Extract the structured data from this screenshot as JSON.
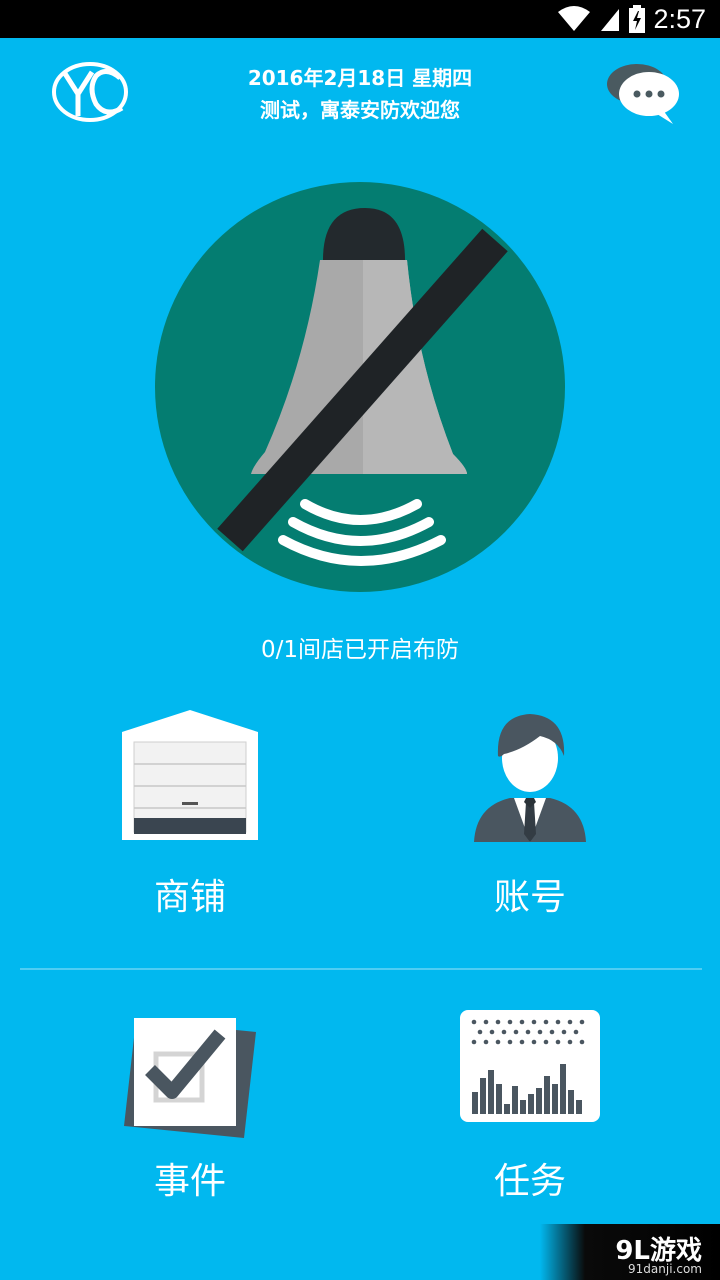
{
  "status_bar": {
    "time": "2:57",
    "icons": [
      "wifi-icon",
      "signal-icon",
      "battery-charging-icon"
    ]
  },
  "header": {
    "logo_text": "YC",
    "date_line": "2016年2月18日 星期四",
    "welcome_line": "测试，寓泰安防欢迎您",
    "chat_icon": "chat-bubble-icon"
  },
  "alarm": {
    "icon": "alarm-disarmed-icon",
    "status_text": "0/1间店已开启布防"
  },
  "tiles": [
    {
      "label": "商铺",
      "icon": "shop-icon"
    },
    {
      "label": "账号",
      "icon": "account-icon"
    },
    {
      "label": "事件",
      "icon": "event-check-icon"
    },
    {
      "label": "任务",
      "icon": "task-chart-icon"
    }
  ],
  "watermark": {
    "main": "9L游戏",
    "sub": "91danji.com"
  },
  "colors": {
    "background": "#01b8ef",
    "circle": "#047d71",
    "slash": "#1f2326",
    "bell": "#aaaaaa"
  }
}
